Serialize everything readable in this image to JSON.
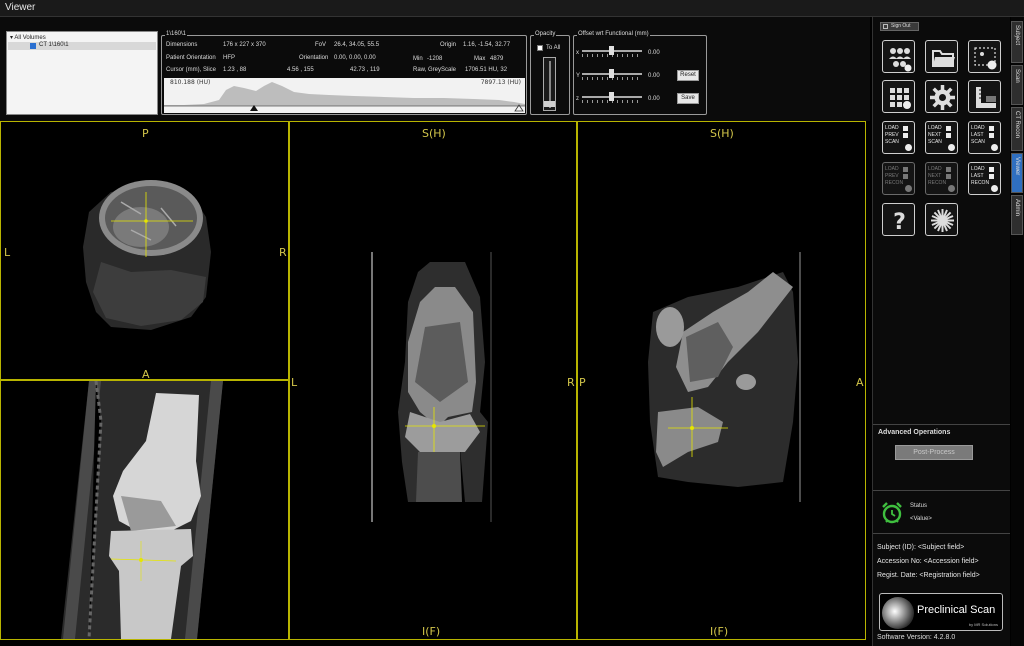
{
  "window": {
    "title": "Viewer"
  },
  "volume_tree": {
    "root_label": "All Volumes",
    "item_label": "CT 1\\160\\1"
  },
  "info_panel": {
    "title": "1\\160\\1",
    "dimensions_label": "Dimensions",
    "dimensions_value": "176 x 227 x 370",
    "fov_label": "FoV",
    "fov_value": "26.4, 34.05, 55.5",
    "origin_label": "Origin",
    "origin_value": "1.16, -1.54, 32.77",
    "patient_orientation_label": "Patient Orientation",
    "patient_orientation_value": "HFP",
    "orientation_label": "Orientation",
    "orientation_value": "0.00, 0.00, 0.00",
    "min_label": "Min",
    "min_value": "-1208",
    "max_label": "Max",
    "max_value": "4879",
    "cursor_label": "Cursor (mm), Slice",
    "cursor_value_1": "1.23 , 88",
    "cursor_value_2": "4.56 , 155",
    "cursor_value_3": "42.73 , 119",
    "raw_label": "Raw, GreyScale",
    "raw_value": "1706.51 HU, 32",
    "histogram_low": "810.188 (HU)",
    "histogram_high": "7897.13 (HU)"
  },
  "opacity_panel": {
    "title": "Opacity",
    "to_all_label": "To All",
    "level": 0.05
  },
  "offset_panel": {
    "title": "Offset wrt Functional (mm)",
    "x_label": "x",
    "x_value": "0.00",
    "y_label": "Y",
    "y_value": "0.00",
    "z_label": "z",
    "z_value": "0.00",
    "reset_label": "Reset",
    "save_label": "Save"
  },
  "viewports": {
    "axial": {
      "top": "P",
      "bottom": "A",
      "left": "L",
      "right": "R"
    },
    "coronal": {
      "top": "S(H)",
      "bottom": "I(F)",
      "left": "L",
      "right": "R"
    },
    "sagittal": {
      "top": "S(H)",
      "bottom": "I(F)",
      "left": "P",
      "right": "A"
    }
  },
  "right_panel": {
    "sign_out_label": "Sign Out",
    "tiles": [
      {
        "name": "load",
        "lines": [
          "LOAD",
          "PREV",
          "SCAN"
        ]
      },
      {
        "name": "next",
        "lines": [
          "LOAD",
          "NEXT",
          "SCAN"
        ]
      },
      {
        "name": "last",
        "lines": [
          "LOAD",
          "LAST",
          "SCAN"
        ]
      },
      {
        "name": "recon-prev",
        "lines": [
          "LOAD",
          "PREV",
          "RECON"
        ]
      },
      {
        "name": "recon-next",
        "lines": [
          "LOAD",
          "NEXT",
          "RECON"
        ]
      },
      {
        "name": "recon-last",
        "lines": [
          "LOAD",
          "LAST",
          "RECON"
        ]
      }
    ],
    "advanced_title": "Advanced Operations",
    "post_process_label": "Post-Process",
    "status_label": "Status",
    "status_value": "<Value>",
    "subject_id": "Subject (ID):  <Subject field>",
    "accession_no": "Accession No:  <Accession field>",
    "regist_date": "Regist. Date:  <Registration field>",
    "logo_name": "Preclinical Scan",
    "logo_sub": "by MR Solutions",
    "software_version": "Software Version:  4.2.8.0"
  },
  "side_tabs": [
    "Subject",
    "Scan",
    "CT Recon",
    "Viewer",
    "Admin"
  ],
  "colors": {
    "accent_blue": "#2f6fc0",
    "viewport_border": "#b8b400",
    "orientation_text": "#d3c64a",
    "crosshair": "#e6e600"
  }
}
